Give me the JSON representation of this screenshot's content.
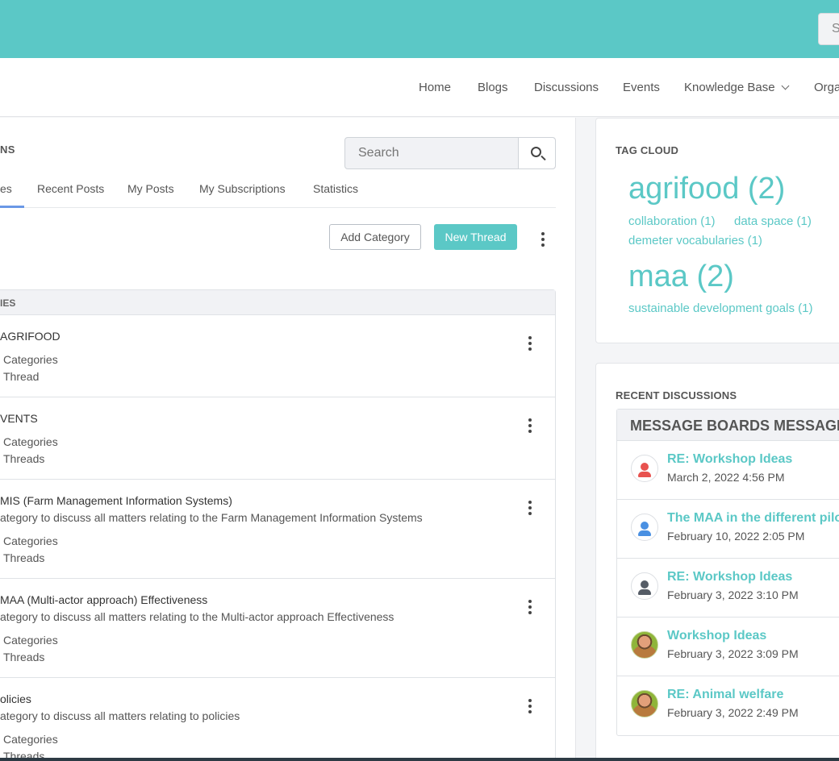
{
  "header": {
    "search_placeholder": "S"
  },
  "nav": {
    "items": [
      "Home",
      "Blogs",
      "Discussions",
      "Events",
      "Knowledge Base",
      "Orga"
    ]
  },
  "main": {
    "section_title": "NS",
    "search_placeholder": "Search",
    "tabs": [
      "es",
      "Recent Posts",
      "My Posts",
      "My Subscriptions",
      "Statistics"
    ],
    "add_category_label": "Add Category",
    "new_thread_label": "New Thread",
    "table_header": "IES",
    "categories": [
      {
        "title": "AGRIFOOD",
        "description": "",
        "categories": "Categories",
        "threads": "Thread"
      },
      {
        "title": "VENTS",
        "description": "",
        "categories": "Categories",
        "threads": "Threads"
      },
      {
        "title": "MIS (Farm Management Information Systems)",
        "description": "ategory to discuss all matters relating to the Farm Management Information Systems",
        "categories": "Categories",
        "threads": "Threads"
      },
      {
        "title": "MAA (Multi-actor approach) Effectiveness",
        "description": "ategory to discuss all matters relating to the Multi-actor approach Effectiveness",
        "categories": "Categories",
        "threads": "Threads"
      },
      {
        "title": "olicies",
        "description": "ategory to discuss all matters relating to policies",
        "categories": "Categories",
        "threads": "Threads"
      }
    ]
  },
  "tag_cloud": {
    "title": "TAG CLOUD",
    "tags": [
      "agrifood (2)",
      "collaboration (1)",
      "data space (1)",
      "demeter vocabularies (1)",
      "maa (2)",
      "sustainable development goals (1)"
    ]
  },
  "recent_discussions": {
    "title": "RECENT DISCUSSIONS",
    "header": "MESSAGE BOARDS MESSAGE",
    "items": [
      {
        "title": "RE: Workshop Ideas",
        "date": "March 2, 2022 4:56 PM",
        "avatar_color": "#e8524f"
      },
      {
        "title": "The MAA in the different pilot",
        "date": "February 10, 2022 2:05 PM",
        "avatar_color": "#4a90e2"
      },
      {
        "title": "RE: Workshop Ideas",
        "date": "February 3, 2022 3:10 PM",
        "avatar_color": "#555c66"
      },
      {
        "title": "Workshop Ideas",
        "date": "February 3, 2022 3:09 PM",
        "avatar_color": "photo"
      },
      {
        "title": "RE: Animal welfare",
        "date": "February 3, 2022 2:49 PM",
        "avatar_color": "photo"
      }
    ]
  },
  "colors": {
    "brand": "#5bc8c6",
    "tab_active": "#6a98e6"
  }
}
